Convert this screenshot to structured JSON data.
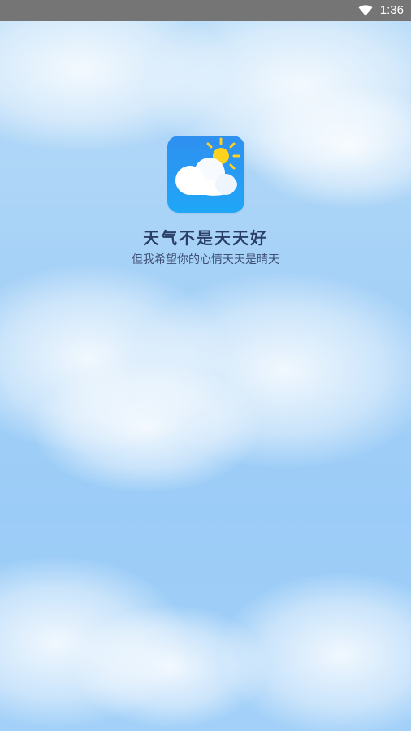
{
  "status_bar": {
    "time": "1:36",
    "icons": [
      "wifi-icon"
    ]
  },
  "splash": {
    "logo_icon": "cloud-sun-icon",
    "title": "天气不是天天好",
    "subtitle": "但我希望你的心情天天是晴天"
  },
  "colors": {
    "status_bar_bg": "#757575",
    "sky_top": "#b9dcf8",
    "sky_bottom": "#9bccf7",
    "logo_gradient_top": "#2f8ff0",
    "logo_gradient_bottom": "#1fa7f6",
    "sun": "#ffd21f",
    "title_text": "#2a3e66",
    "subtitle_text": "#3d4f73"
  }
}
